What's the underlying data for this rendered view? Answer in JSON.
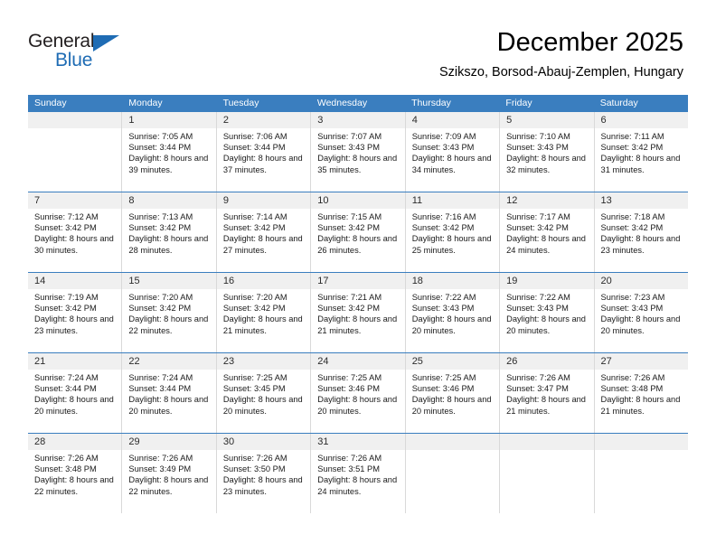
{
  "brand": {
    "name_top": "General",
    "name_bottom": "Blue",
    "accent_color": "#1f6cb4"
  },
  "header": {
    "title": "December 2025",
    "subtitle": "Szikszo, Borsod-Abauj-Zemplen, Hungary"
  },
  "calendar": {
    "header_bg": "#3a7ebf",
    "daynumber_bg": "#f0f0f0",
    "weekdays": [
      "Sunday",
      "Monday",
      "Tuesday",
      "Wednesday",
      "Thursday",
      "Friday",
      "Saturday"
    ],
    "weeks": [
      [
        {
          "day": "",
          "empty": true
        },
        {
          "day": "1",
          "sunrise": "Sunrise: 7:05 AM",
          "sunset": "Sunset: 3:44 PM",
          "daylight": "Daylight: 8 hours and 39 minutes."
        },
        {
          "day": "2",
          "sunrise": "Sunrise: 7:06 AM",
          "sunset": "Sunset: 3:44 PM",
          "daylight": "Daylight: 8 hours and 37 minutes."
        },
        {
          "day": "3",
          "sunrise": "Sunrise: 7:07 AM",
          "sunset": "Sunset: 3:43 PM",
          "daylight": "Daylight: 8 hours and 35 minutes."
        },
        {
          "day": "4",
          "sunrise": "Sunrise: 7:09 AM",
          "sunset": "Sunset: 3:43 PM",
          "daylight": "Daylight: 8 hours and 34 minutes."
        },
        {
          "day": "5",
          "sunrise": "Sunrise: 7:10 AM",
          "sunset": "Sunset: 3:43 PM",
          "daylight": "Daylight: 8 hours and 32 minutes."
        },
        {
          "day": "6",
          "sunrise": "Sunrise: 7:11 AM",
          "sunset": "Sunset: 3:42 PM",
          "daylight": "Daylight: 8 hours and 31 minutes."
        }
      ],
      [
        {
          "day": "7",
          "sunrise": "Sunrise: 7:12 AM",
          "sunset": "Sunset: 3:42 PM",
          "daylight": "Daylight: 8 hours and 30 minutes."
        },
        {
          "day": "8",
          "sunrise": "Sunrise: 7:13 AM",
          "sunset": "Sunset: 3:42 PM",
          "daylight": "Daylight: 8 hours and 28 minutes."
        },
        {
          "day": "9",
          "sunrise": "Sunrise: 7:14 AM",
          "sunset": "Sunset: 3:42 PM",
          "daylight": "Daylight: 8 hours and 27 minutes."
        },
        {
          "day": "10",
          "sunrise": "Sunrise: 7:15 AM",
          "sunset": "Sunset: 3:42 PM",
          "daylight": "Daylight: 8 hours and 26 minutes."
        },
        {
          "day": "11",
          "sunrise": "Sunrise: 7:16 AM",
          "sunset": "Sunset: 3:42 PM",
          "daylight": "Daylight: 8 hours and 25 minutes."
        },
        {
          "day": "12",
          "sunrise": "Sunrise: 7:17 AM",
          "sunset": "Sunset: 3:42 PM",
          "daylight": "Daylight: 8 hours and 24 minutes."
        },
        {
          "day": "13",
          "sunrise": "Sunrise: 7:18 AM",
          "sunset": "Sunset: 3:42 PM",
          "daylight": "Daylight: 8 hours and 23 minutes."
        }
      ],
      [
        {
          "day": "14",
          "sunrise": "Sunrise: 7:19 AM",
          "sunset": "Sunset: 3:42 PM",
          "daylight": "Daylight: 8 hours and 23 minutes."
        },
        {
          "day": "15",
          "sunrise": "Sunrise: 7:20 AM",
          "sunset": "Sunset: 3:42 PM",
          "daylight": "Daylight: 8 hours and 22 minutes."
        },
        {
          "day": "16",
          "sunrise": "Sunrise: 7:20 AM",
          "sunset": "Sunset: 3:42 PM",
          "daylight": "Daylight: 8 hours and 21 minutes."
        },
        {
          "day": "17",
          "sunrise": "Sunrise: 7:21 AM",
          "sunset": "Sunset: 3:42 PM",
          "daylight": "Daylight: 8 hours and 21 minutes."
        },
        {
          "day": "18",
          "sunrise": "Sunrise: 7:22 AM",
          "sunset": "Sunset: 3:43 PM",
          "daylight": "Daylight: 8 hours and 20 minutes."
        },
        {
          "day": "19",
          "sunrise": "Sunrise: 7:22 AM",
          "sunset": "Sunset: 3:43 PM",
          "daylight": "Daylight: 8 hours and 20 minutes."
        },
        {
          "day": "20",
          "sunrise": "Sunrise: 7:23 AM",
          "sunset": "Sunset: 3:43 PM",
          "daylight": "Daylight: 8 hours and 20 minutes."
        }
      ],
      [
        {
          "day": "21",
          "sunrise": "Sunrise: 7:24 AM",
          "sunset": "Sunset: 3:44 PM",
          "daylight": "Daylight: 8 hours and 20 minutes."
        },
        {
          "day": "22",
          "sunrise": "Sunrise: 7:24 AM",
          "sunset": "Sunset: 3:44 PM",
          "daylight": "Daylight: 8 hours and 20 minutes."
        },
        {
          "day": "23",
          "sunrise": "Sunrise: 7:25 AM",
          "sunset": "Sunset: 3:45 PM",
          "daylight": "Daylight: 8 hours and 20 minutes."
        },
        {
          "day": "24",
          "sunrise": "Sunrise: 7:25 AM",
          "sunset": "Sunset: 3:46 PM",
          "daylight": "Daylight: 8 hours and 20 minutes."
        },
        {
          "day": "25",
          "sunrise": "Sunrise: 7:25 AM",
          "sunset": "Sunset: 3:46 PM",
          "daylight": "Daylight: 8 hours and 20 minutes."
        },
        {
          "day": "26",
          "sunrise": "Sunrise: 7:26 AM",
          "sunset": "Sunset: 3:47 PM",
          "daylight": "Daylight: 8 hours and 21 minutes."
        },
        {
          "day": "27",
          "sunrise": "Sunrise: 7:26 AM",
          "sunset": "Sunset: 3:48 PM",
          "daylight": "Daylight: 8 hours and 21 minutes."
        }
      ],
      [
        {
          "day": "28",
          "sunrise": "Sunrise: 7:26 AM",
          "sunset": "Sunset: 3:48 PM",
          "daylight": "Daylight: 8 hours and 22 minutes."
        },
        {
          "day": "29",
          "sunrise": "Sunrise: 7:26 AM",
          "sunset": "Sunset: 3:49 PM",
          "daylight": "Daylight: 8 hours and 22 minutes."
        },
        {
          "day": "30",
          "sunrise": "Sunrise: 7:26 AM",
          "sunset": "Sunset: 3:50 PM",
          "daylight": "Daylight: 8 hours and 23 minutes."
        },
        {
          "day": "31",
          "sunrise": "Sunrise: 7:26 AM",
          "sunset": "Sunset: 3:51 PM",
          "daylight": "Daylight: 8 hours and 24 minutes."
        },
        {
          "day": "",
          "empty": true
        },
        {
          "day": "",
          "empty": true
        },
        {
          "day": "",
          "empty": true
        }
      ]
    ]
  }
}
